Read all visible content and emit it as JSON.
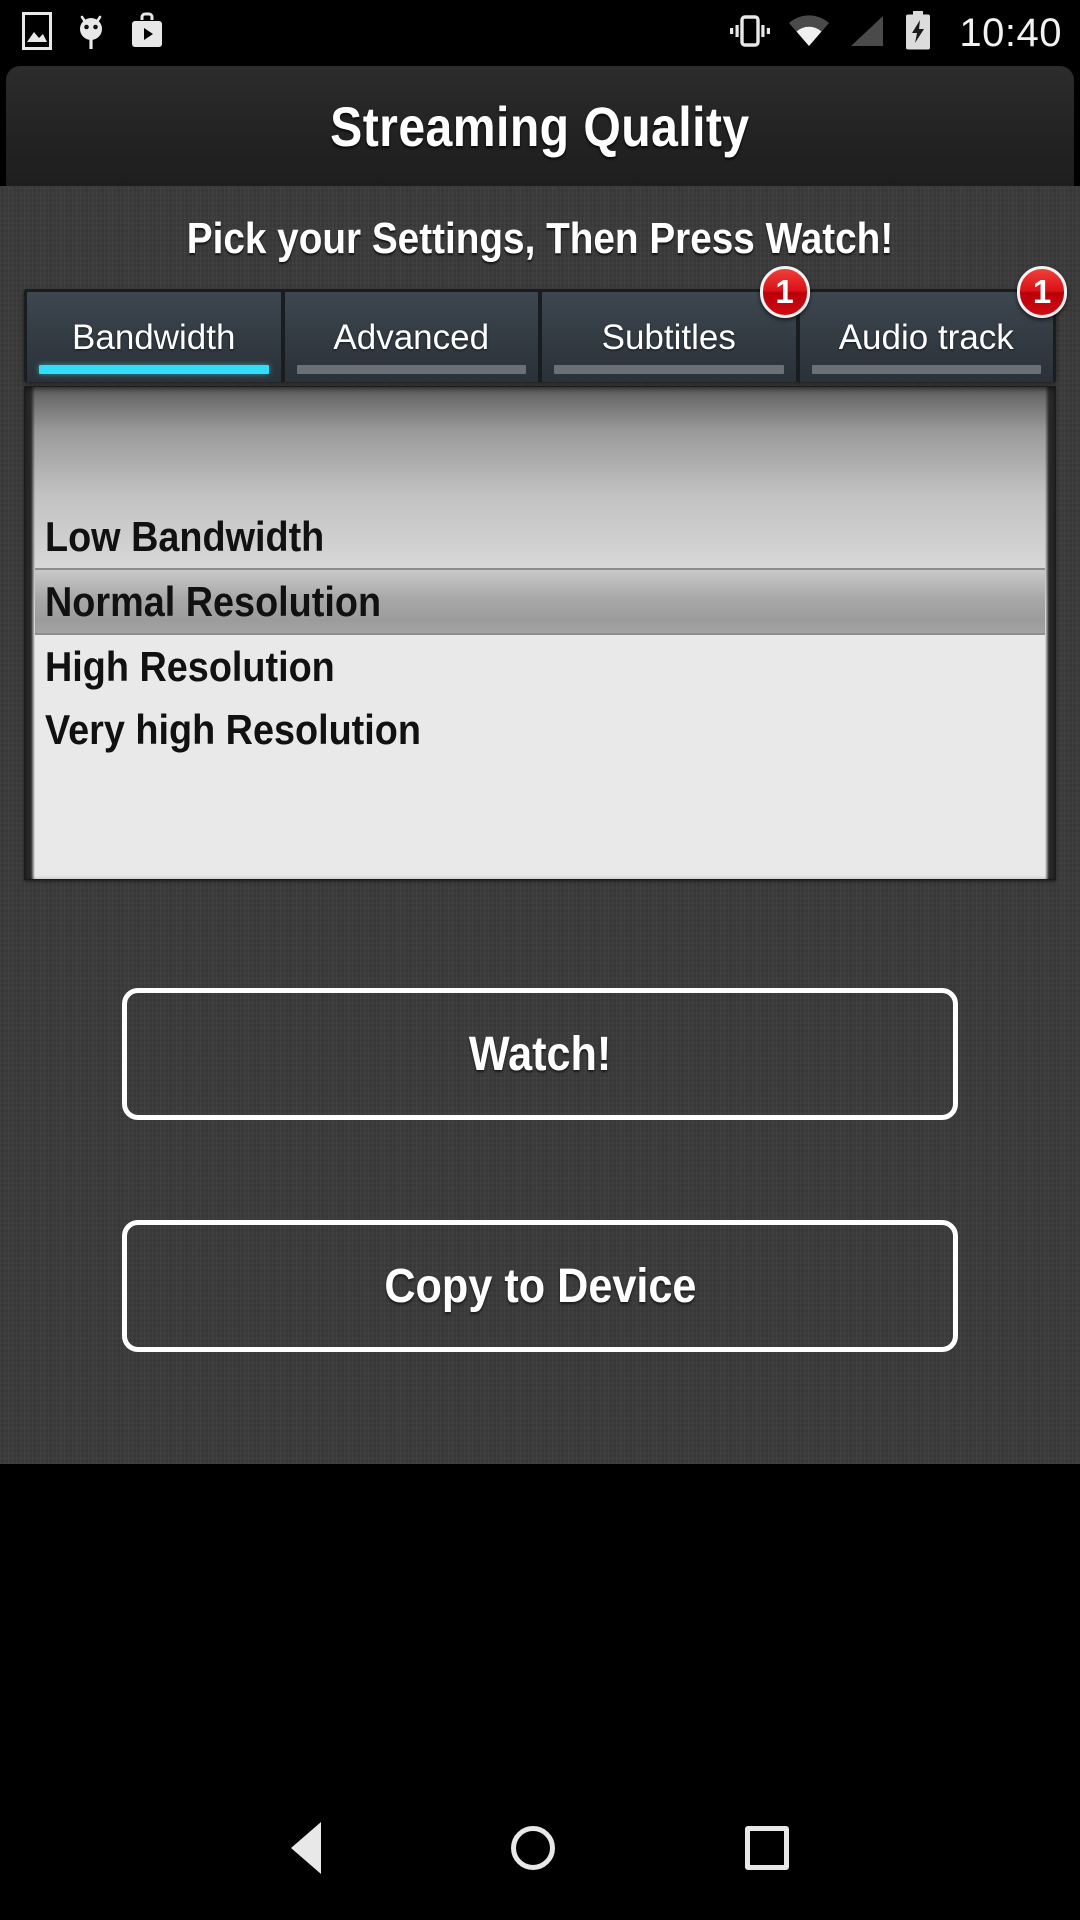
{
  "statusbar": {
    "time": "10:40",
    "icons_left": [
      "gallery-image-icon",
      "android-debug-icon",
      "play-store-icon"
    ],
    "icons_right": [
      "vibrate-icon",
      "wifi-icon",
      "cell-signal-icon",
      "battery-charging-icon"
    ]
  },
  "header": {
    "title": "Streaming Quality"
  },
  "main": {
    "subtitle": "Pick your Settings, Then Press Watch!",
    "tabs": [
      {
        "label": "Bandwidth",
        "active": true,
        "badge": null
      },
      {
        "label": "Advanced",
        "active": false,
        "badge": null
      },
      {
        "label": "Subtitles",
        "active": false,
        "badge": "1"
      },
      {
        "label": "Audio track",
        "active": false,
        "badge": "1"
      }
    ],
    "list": {
      "items": [
        {
          "label": "Low Bandwidth",
          "selected": false
        },
        {
          "label": "Normal Resolution",
          "selected": true
        },
        {
          "label": "High Resolution",
          "selected": false
        },
        {
          "label": "Very high Resolution",
          "selected": false
        }
      ]
    },
    "buttons": {
      "watch": "Watch!",
      "copy": "Copy to Device"
    }
  },
  "navbar": {
    "back": "back-icon",
    "home": "home-icon",
    "recents": "recents-icon"
  },
  "colors": {
    "accent": "#33dcf7",
    "badge": "#d91016",
    "background": "#3b3b3b",
    "titlebar": "#232323"
  }
}
